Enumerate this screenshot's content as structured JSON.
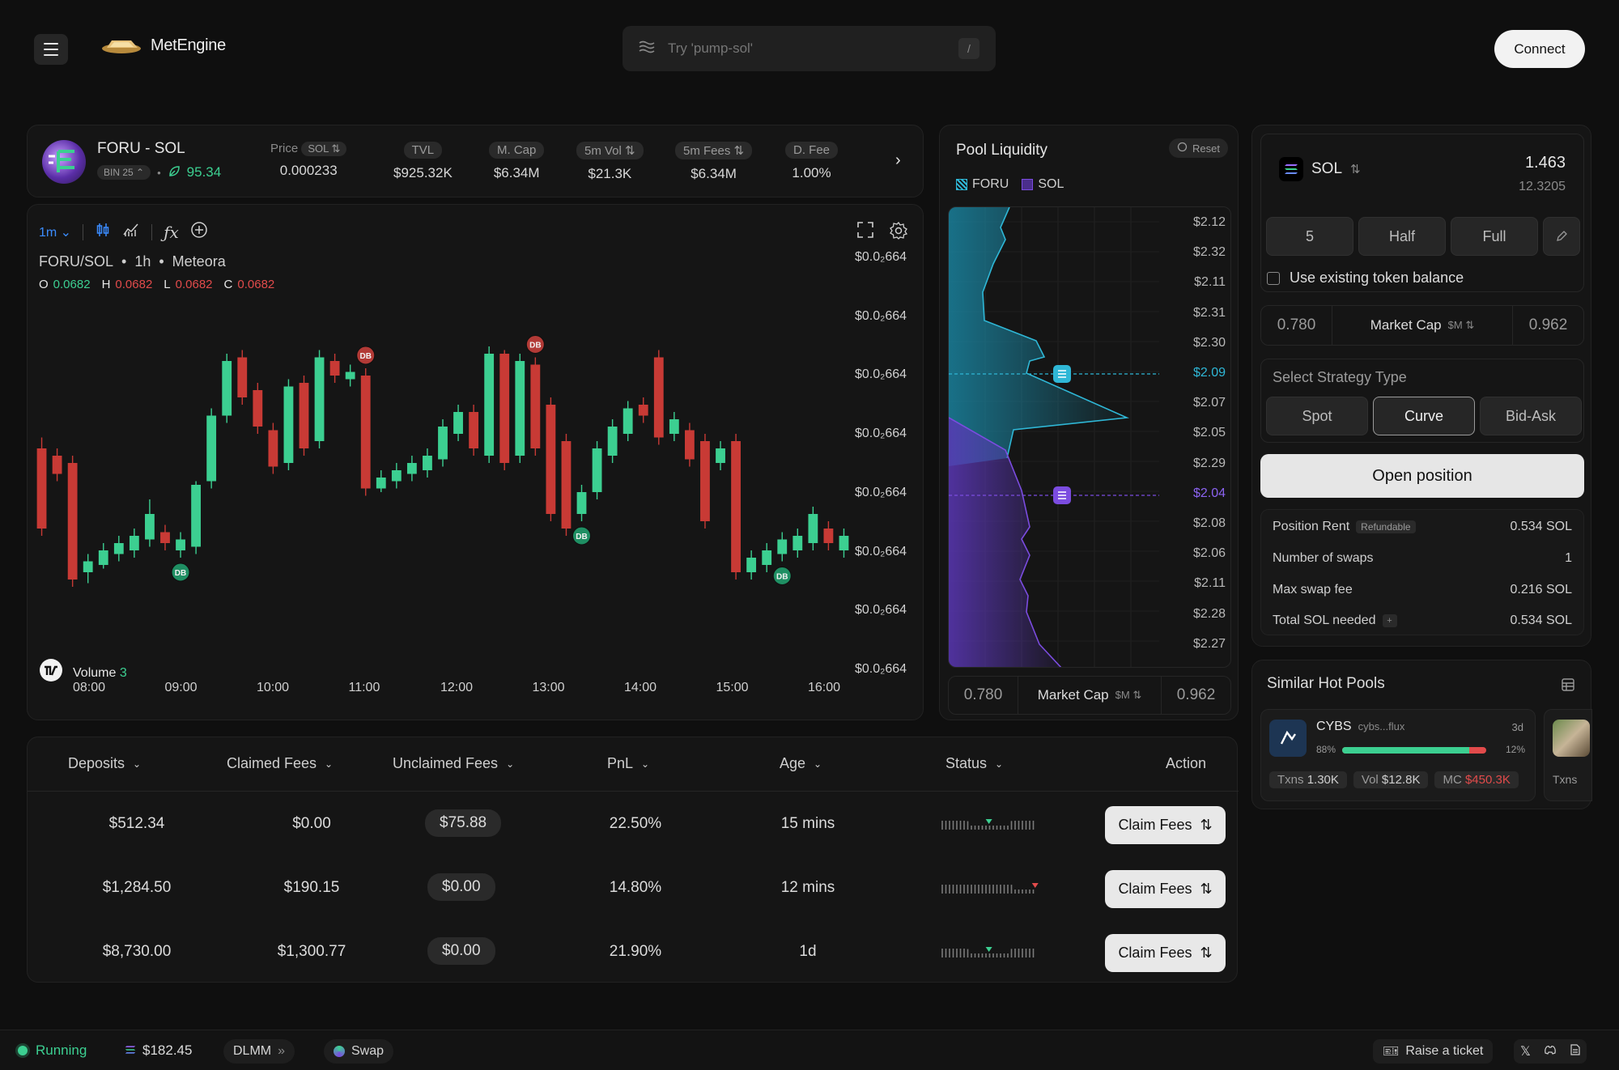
{
  "header": {
    "brand": "MetEngine",
    "search_placeholder": "Try 'pump-sol'",
    "search_kbd": "/",
    "connect_label": "Connect"
  },
  "token": {
    "pair": "FORU - SOL",
    "bin_label": "BIN 25",
    "score": "95.34",
    "stats": [
      {
        "label": "Price",
        "unit": "SOL",
        "value": "0.000233"
      },
      {
        "label": "TVL",
        "value": "$925.32K"
      },
      {
        "label": "M. Cap",
        "value": "$6.34M"
      },
      {
        "label": "5m Vol",
        "value": "$21.3K"
      },
      {
        "label": "5m Fees",
        "value": "$6.34M"
      },
      {
        "label": "D. Fee",
        "value": "1.00%"
      }
    ]
  },
  "chart": {
    "interval": "1m",
    "symbol": "FORU/SOL",
    "timeframe": "1h",
    "venue": "Meteora",
    "ohlc": {
      "o": "0.0682",
      "h": "0.0682",
      "l": "0.0682",
      "c": "0.0682"
    },
    "volume_label": "Volume",
    "volume_value": "3",
    "price_labels": [
      "$0.0₂664",
      "$0.0₂664",
      "$0.0₂664",
      "$0.0₂664",
      "$0.0₂664",
      "$0.0₂664",
      "$0.0₂664",
      "$0.0₂664"
    ],
    "time_labels": [
      "08:00",
      "09:00",
      "10:00",
      "11:00",
      "12:00",
      "13:00",
      "14:00",
      "15:00",
      "16:00"
    ],
    "marker_label": "DB"
  },
  "chart_data": {
    "type": "candlestick",
    "title": "FORU/SOL",
    "x": [
      "08:00",
      "09:00",
      "10:00",
      "11:00",
      "12:00",
      "13:00",
      "14:00",
      "15:00",
      "16:00"
    ],
    "ylabel": "",
    "series": [
      {
        "candles": [
          [
            0.62,
            0.4,
            0.65,
            0.38
          ],
          [
            0.6,
            0.55,
            0.62,
            0.53
          ],
          [
            0.58,
            0.26,
            0.6,
            0.24
          ],
          [
            0.28,
            0.31,
            0.33,
            0.25
          ],
          [
            0.3,
            0.34,
            0.36,
            0.29
          ],
          [
            0.33,
            0.36,
            0.38,
            0.31
          ],
          [
            0.34,
            0.38,
            0.4,
            0.32
          ],
          [
            0.37,
            0.44,
            0.48,
            0.35
          ],
          [
            0.39,
            0.36,
            0.41,
            0.34
          ],
          [
            0.34,
            0.37,
            0.39,
            0.32
          ],
          [
            0.35,
            0.52,
            0.53,
            0.33
          ],
          [
            0.53,
            0.71,
            0.73,
            0.51
          ],
          [
            0.71,
            0.86,
            0.88,
            0.69
          ],
          [
            0.87,
            0.76,
            0.89,
            0.74
          ],
          [
            0.78,
            0.68,
            0.8,
            0.66
          ],
          [
            0.67,
            0.57,
            0.69,
            0.55
          ],
          [
            0.58,
            0.79,
            0.81,
            0.56
          ],
          [
            0.8,
            0.62,
            0.82,
            0.6
          ],
          [
            0.64,
            0.87,
            0.89,
            0.62
          ],
          [
            0.86,
            0.82,
            0.88,
            0.8
          ],
          [
            0.81,
            0.83,
            0.85,
            0.79
          ],
          [
            0.82,
            0.51,
            0.84,
            0.49
          ],
          [
            0.51,
            0.54,
            0.56,
            0.5
          ],
          [
            0.53,
            0.56,
            0.58,
            0.51
          ],
          [
            0.55,
            0.58,
            0.6,
            0.53
          ],
          [
            0.56,
            0.6,
            0.62,
            0.54
          ],
          [
            0.59,
            0.68,
            0.7,
            0.57
          ],
          [
            0.66,
            0.72,
            0.74,
            0.64
          ],
          [
            0.72,
            0.62,
            0.74,
            0.6
          ],
          [
            0.6,
            0.88,
            0.9,
            0.58
          ],
          [
            0.88,
            0.58,
            0.89,
            0.56
          ],
          [
            0.6,
            0.86,
            0.88,
            0.58
          ],
          [
            0.85,
            0.62,
            0.87,
            0.6
          ],
          [
            0.74,
            0.44,
            0.76,
            0.42
          ],
          [
            0.64,
            0.4,
            0.66,
            0.38
          ],
          [
            0.44,
            0.5,
            0.52,
            0.42
          ],
          [
            0.5,
            0.62,
            0.64,
            0.48
          ],
          [
            0.6,
            0.68,
            0.7,
            0.58
          ],
          [
            0.66,
            0.73,
            0.75,
            0.64
          ],
          [
            0.74,
            0.71,
            0.76,
            0.69
          ],
          [
            0.87,
            0.65,
            0.89,
            0.63
          ],
          [
            0.66,
            0.7,
            0.72,
            0.64
          ],
          [
            0.67,
            0.59,
            0.69,
            0.57
          ],
          [
            0.64,
            0.42,
            0.66,
            0.4
          ],
          [
            0.58,
            0.62,
            0.64,
            0.56
          ],
          [
            0.64,
            0.28,
            0.66,
            0.26
          ],
          [
            0.28,
            0.32,
            0.34,
            0.26
          ],
          [
            0.3,
            0.34,
            0.36,
            0.28
          ],
          [
            0.33,
            0.37,
            0.39,
            0.31
          ],
          [
            0.34,
            0.38,
            0.4,
            0.32
          ],
          [
            0.36,
            0.44,
            0.46,
            0.34
          ],
          [
            0.4,
            0.36,
            0.42,
            0.34
          ],
          [
            0.34,
            0.38,
            0.4,
            0.32
          ]
        ]
      }
    ],
    "markers": [
      {
        "index": 9,
        "label": "DB"
      },
      {
        "index": 21,
        "label": "DB"
      },
      {
        "index": 32,
        "label": "DB"
      },
      {
        "index": 35,
        "label": "DB"
      },
      {
        "index": 48,
        "label": "DB"
      }
    ]
  },
  "liquidity": {
    "title": "Pool Liquidity",
    "reset_label": "Reset",
    "legend": [
      "FORU",
      "SOL"
    ],
    "price_labels": [
      "$2.12",
      "$2.32",
      "$2.11",
      "$2.31",
      "$2.30",
      "$2.09",
      "$2.07",
      "$2.05",
      "$2.29",
      "$2.04",
      "$2.08",
      "$2.06",
      "$2.11",
      "$2.28",
      "$2.27"
    ],
    "active_upper": "$2.09",
    "active_lower": "$2.04",
    "range_min": "0.780",
    "range_max": "0.962",
    "range_label": "Market Cap",
    "range_unit": "$M"
  },
  "deposit": {
    "token": "SOL",
    "amount": "1.463",
    "balance": "12.3205",
    "quick": [
      "5",
      "Half",
      "Full"
    ],
    "use_existing": "Use existing token balance",
    "range_min": "0.780",
    "range_label": "Market Cap",
    "range_unit": "$M",
    "range_max": "0.962",
    "strategy_title": "Select Strategy Type",
    "strategies": [
      "Spot",
      "Curve",
      "Bid-Ask"
    ],
    "open_label": "Open position",
    "summary": [
      {
        "label": "Position Rent",
        "tag": "Refundable",
        "value": "0.534 SOL"
      },
      {
        "label": "Number of swaps",
        "value": "1"
      },
      {
        "label": "Max swap fee",
        "value": "0.216 SOL"
      },
      {
        "label": "Total SOL needed",
        "value": "0.534 SOL"
      }
    ]
  },
  "similar": {
    "title": "Similar Hot Pools",
    "pool": {
      "ticker": "CYBS",
      "address": "cybs...flux",
      "age": "3d",
      "left_pct": "88%",
      "right_pct": "12%",
      "txns": "1.30K",
      "vol": "$12.8K",
      "mc": "$450.3K",
      "txns_label": "Txns",
      "vol_label": "Vol",
      "mc_label": "MC"
    },
    "next_label": "Txns"
  },
  "positions": {
    "headers": [
      "Deposits",
      "Claimed Fees",
      "Unclaimed Fees",
      "PnL",
      "Age",
      "Status",
      "Action"
    ],
    "claim_label": "Claim Fees",
    "rows": [
      {
        "deposit": "$512.34",
        "claimed": "$0.00",
        "unclaimed": "$75.88",
        "pnl": "22.50%",
        "age": "15 mins",
        "status_pos": 0.47,
        "status_color": "#3ccf91"
      },
      {
        "deposit": "$1,284.50",
        "claimed": "$190.15",
        "unclaimed": "$0.00",
        "pnl": "14.80%",
        "age": "12 mins",
        "status_pos": 0.98,
        "status_color": "#e24b4b"
      },
      {
        "deposit": "$8,730.00",
        "claimed": "$1,300.77",
        "unclaimed": "$0.00",
        "pnl": "21.90%",
        "age": "1d",
        "status_pos": 0.47,
        "status_color": "#3ccf91"
      }
    ]
  },
  "footer": {
    "status": "Running",
    "sol_price": "$182.45",
    "dlmm": "DLMM",
    "swap": "Swap",
    "ticket": "Raise a ticket"
  },
  "colors": {
    "green": "#3ccf91",
    "red": "#c83a35",
    "cyan": "#2fb7d6",
    "purple": "#7b4ce0"
  }
}
